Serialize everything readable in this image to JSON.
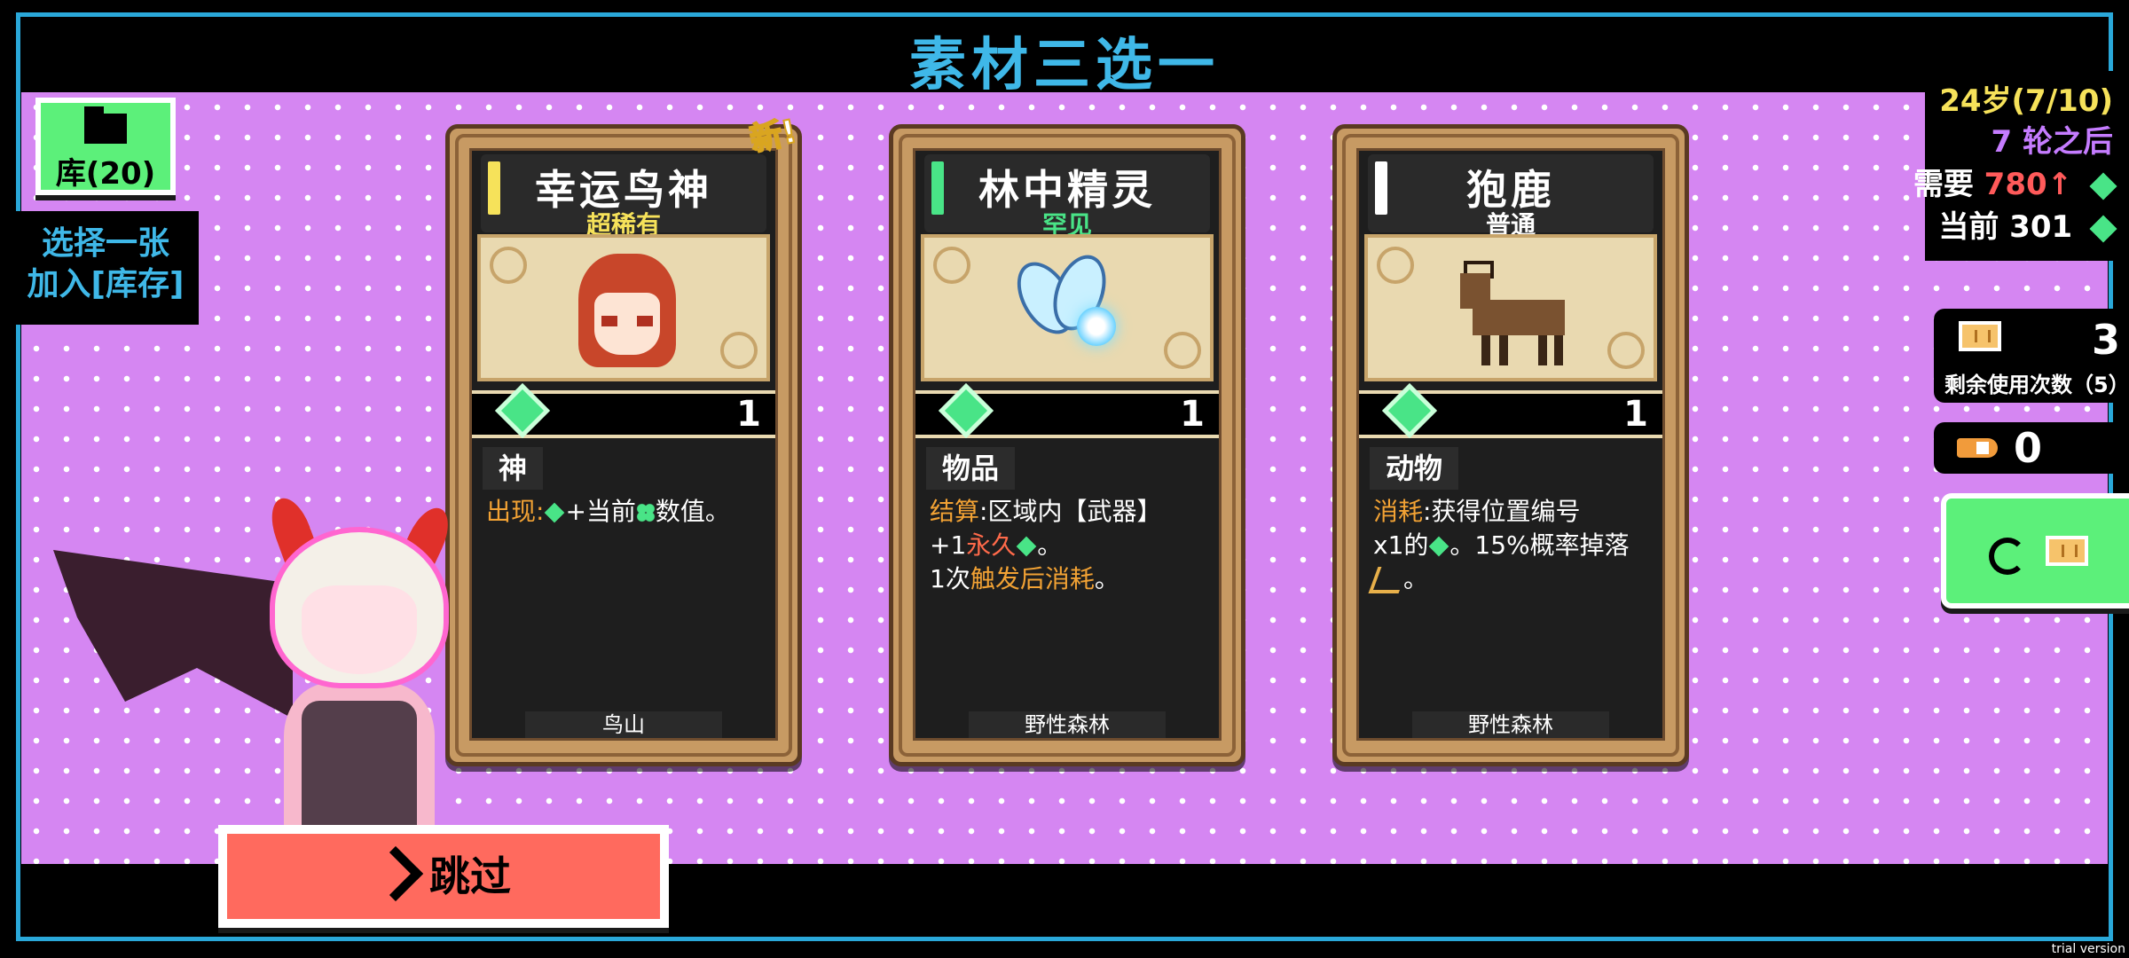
{
  "title": "素材三选一",
  "inventory": {
    "label": "库(20)",
    "icon": "folder-icon"
  },
  "choose_tip": {
    "line1": "选择一张",
    "line2": "加入[库存]"
  },
  "hud": {
    "age": "24岁(7/10)",
    "rounds": "7 轮之后",
    "need_label": "需要",
    "need_value": "780",
    "need_arrow": "↑",
    "current_label": "当前",
    "current_value": "301",
    "gem_icon": "gem-icon"
  },
  "tickets": {
    "count": "3",
    "label": "剩余使用次数（5）",
    "icon": "ticket-icon"
  },
  "bullets": {
    "count": "0",
    "icon": "bullet-icon"
  },
  "refresh": {
    "icon": "refresh-icon",
    "cost_icon": "ticket-icon"
  },
  "new_badge": "新!",
  "cards": [
    {
      "name": "幸运鸟神",
      "rarity": "超稀有",
      "rarity_color": "#f6e25a",
      "value": "1",
      "type": "神",
      "desc": {
        "kw": "出现",
        "colon": ":",
        "text1": "+当前",
        "text2": "数值。"
      },
      "region": "鸟山"
    },
    {
      "name": "林中精灵",
      "rarity": "罕见",
      "rarity_color": "#49e487",
      "value": "1",
      "type": "物品",
      "desc": {
        "kw": "结算",
        "colon": ":",
        "line1": "区域内【武器】",
        "prefix2": "+1",
        "kw2": "永久",
        "tail2": "。",
        "prefix3": "1次",
        "kw3": "触发后消耗",
        "tail3": "。"
      },
      "region": "野性森林"
    },
    {
      "name": "狍鹿",
      "rarity": "普通",
      "rarity_color": "#ffffff",
      "value": "1",
      "type": "动物",
      "desc": {
        "kw": "消耗",
        "colon": ":",
        "line1": "获得位置编号",
        "prefix2": "x1的",
        "tail2": "。15%概率掉落",
        "tail3": "。"
      },
      "region": "野性森林"
    }
  ],
  "skip": {
    "label": "跳过",
    "icon": "skip-arrow-icon"
  },
  "trial": "trial version"
}
